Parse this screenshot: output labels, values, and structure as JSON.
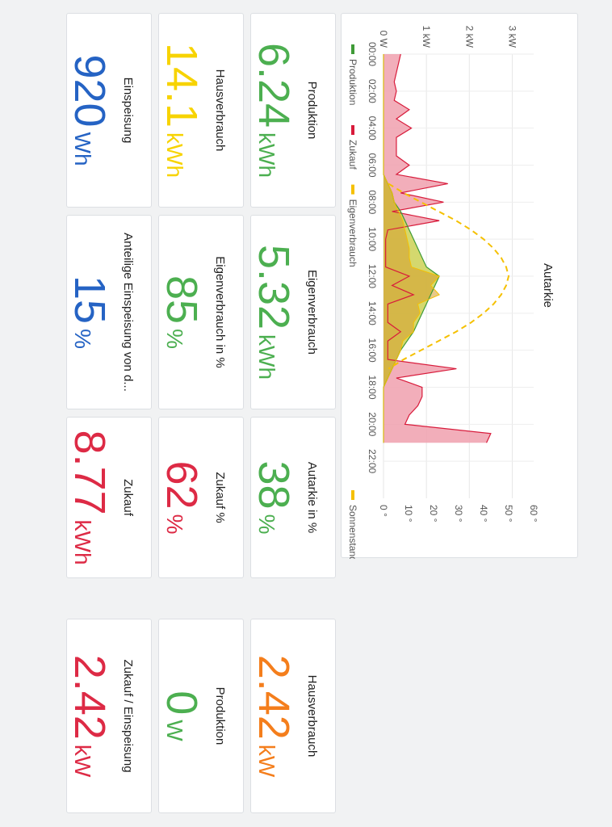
{
  "colors": {
    "green": "#4caf50",
    "yellow": "#f7d300",
    "blue": "#2563c4",
    "red": "#dd2a45",
    "orange": "#f47e1c",
    "production_line": "#3f9b37",
    "purchase_line": "#d81b3b",
    "purchase_fill": "#f0a0ae",
    "selfuse_fill": "#cfd45e",
    "selfuse_dark": "#d69c2a",
    "sun": "#f5c000"
  },
  "stats": [
    {
      "title": "Produktion",
      "value": "6.24",
      "unit": "kWh",
      "color": "green"
    },
    {
      "title": "Eigenverbrauch",
      "value": "5.32",
      "unit": "kWh",
      "color": "green"
    },
    {
      "title": "Autarkie in %",
      "value": "38",
      "unit": "%",
      "color": "green"
    },
    {
      "title": "Hausverbrauch",
      "value": "2.42",
      "unit": "kW",
      "color": "orange"
    },
    {
      "title": "Hausverbrauch",
      "value": "14.1",
      "unit": "kWh",
      "color": "yellow"
    },
    {
      "title": "Eigenverbrauch in %",
      "value": "85",
      "unit": "%",
      "color": "green"
    },
    {
      "title": "Zukauf %",
      "value": "62",
      "unit": "%",
      "color": "red"
    },
    {
      "title": "Produktion",
      "value": "0",
      "unit": "W",
      "color": "green"
    },
    {
      "title": "Einspeisung",
      "value": "920",
      "unit": "Wh",
      "color": "blue"
    },
    {
      "title": "Anteilige Einspeisung von d...",
      "value": "15",
      "unit": "%",
      "color": "blue"
    },
    {
      "title": "Zukauf",
      "value": "8.77",
      "unit": "kWh",
      "color": "red"
    },
    {
      "title": "Zukauf / Einspeisung",
      "value": "2.42",
      "unit": "kW",
      "color": "red"
    }
  ],
  "chart_data": {
    "type": "area",
    "title": "Autarkie",
    "x_tick_labels": [
      "00:00",
      "02:00",
      "04:00",
      "06:00",
      "08:00",
      "10:00",
      "12:00",
      "14:00",
      "16:00",
      "18:00",
      "20:00",
      "22:00"
    ],
    "y_left_ticks": [
      "0 W",
      "1 kW",
      "2 kW",
      "3 kW"
    ],
    "y_right_ticks": [
      "0 °",
      "10 °",
      "20 °",
      "30 °",
      "40 °",
      "50 °",
      "60 °"
    ],
    "ylim_left_kw": [
      0,
      3.5
    ],
    "ylim_right_deg": [
      0,
      60
    ],
    "legend_left": [
      "Produktion",
      "Zukauf",
      "Eigenverbrauch"
    ],
    "legend_right": [
      "Sonnenstand"
    ],
    "x_hours": [
      0,
      0.5,
      1,
      1.5,
      2,
      2.5,
      3,
      3.5,
      4,
      4.5,
      5,
      5.5,
      6,
      6.5,
      7,
      7.5,
      8,
      8.5,
      9,
      9.5,
      10,
      10.5,
      11,
      11.5,
      12,
      12.5,
      13,
      13.5,
      14,
      14.5,
      15,
      15.5,
      16,
      16.5,
      17,
      17.5,
      18,
      18.5,
      19,
      19.5,
      20,
      20.5,
      21
    ],
    "series": [
      {
        "name": "Zukauf",
        "unit": "kW",
        "values": [
          0.4,
          0.35,
          0.3,
          0.25,
          0.3,
          0.25,
          0.6,
          0.3,
          0.65,
          0.3,
          0.3,
          0.3,
          0.6,
          0.3,
          1.5,
          0.4,
          1.4,
          0.2,
          1.3,
          0.1,
          0.05,
          0.05,
          0.05,
          0.05,
          0.6,
          0.2,
          0.7,
          0.1,
          0.1,
          0.1,
          0.4,
          0.1,
          0.1,
          0.1,
          1.7,
          0.3,
          0.9,
          0.9,
          0.8,
          0.6,
          0.5,
          2.5,
          2.4
        ]
      },
      {
        "name": "Produktion",
        "unit": "kW",
        "values": [
          0,
          0,
          0,
          0,
          0,
          0,
          0,
          0,
          0,
          0,
          0,
          0,
          0,
          0,
          0.1,
          0.2,
          0.25,
          0.4,
          0.5,
          0.6,
          0.7,
          0.8,
          0.9,
          1.0,
          1.3,
          1.2,
          1.1,
          1.0,
          0.9,
          0.8,
          0.7,
          0.55,
          0.4,
          0.3,
          0.2,
          0.1,
          0,
          0,
          0,
          0,
          0,
          0,
          0
        ]
      },
      {
        "name": "Eigenverbrauch",
        "unit": "kW",
        "values": [
          0,
          0,
          0,
          0,
          0,
          0,
          0,
          0,
          0,
          0,
          0,
          0,
          0,
          0,
          0.1,
          0.2,
          0.25,
          0.35,
          0.45,
          0.5,
          0.55,
          0.6,
          0.6,
          0.65,
          1.3,
          1.1,
          1.3,
          0.8,
          0.85,
          0.7,
          0.7,
          0.45,
          0.4,
          0.3,
          0.2,
          0.1,
          0,
          0,
          0,
          0,
          0,
          0,
          0
        ]
      },
      {
        "name": "Sonnenstand",
        "unit": "deg",
        "values": [
          null,
          null,
          null,
          null,
          null,
          null,
          null,
          null,
          null,
          null,
          null,
          null,
          null,
          null,
          2,
          8,
          15,
          22,
          29,
          35,
          40,
          44,
          47,
          49,
          50,
          49,
          47,
          44,
          40,
          35,
          29,
          22,
          15,
          8,
          2,
          null,
          null,
          null,
          null,
          null,
          null,
          null,
          null
        ]
      }
    ]
  }
}
